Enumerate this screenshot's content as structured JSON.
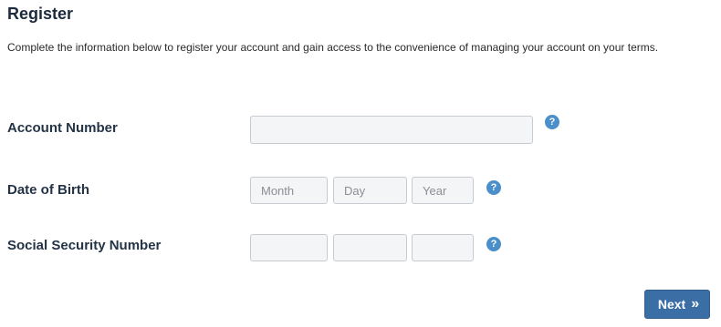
{
  "header": {
    "title": "Register",
    "intro": "Complete the information below to register your account and gain access to the convenience of managing your account on your terms."
  },
  "form": {
    "account_number": {
      "label": "Account Number",
      "value": "",
      "help_icon": "question-mark-icon",
      "help_glyph": "?"
    },
    "date_of_birth": {
      "label": "Date of Birth",
      "month_placeholder": "Month",
      "day_placeholder": "Day",
      "year_placeholder": "Year",
      "help_icon": "question-mark-icon",
      "help_glyph": "?"
    },
    "ssn": {
      "label": "Social Security Number",
      "part1": "",
      "part2": "",
      "part3": "",
      "help_icon": "question-mark-icon",
      "help_glyph": "?"
    }
  },
  "actions": {
    "next_label": "Next",
    "next_icon": "double-chevron-right-icon",
    "next_glyph": "»"
  },
  "colors": {
    "accent": "#3a6ea5",
    "help_icon": "#4a8fc9",
    "field_bg": "#f4f5f6",
    "field_border": "#c6cbd1",
    "title": "#1b2a3c"
  }
}
